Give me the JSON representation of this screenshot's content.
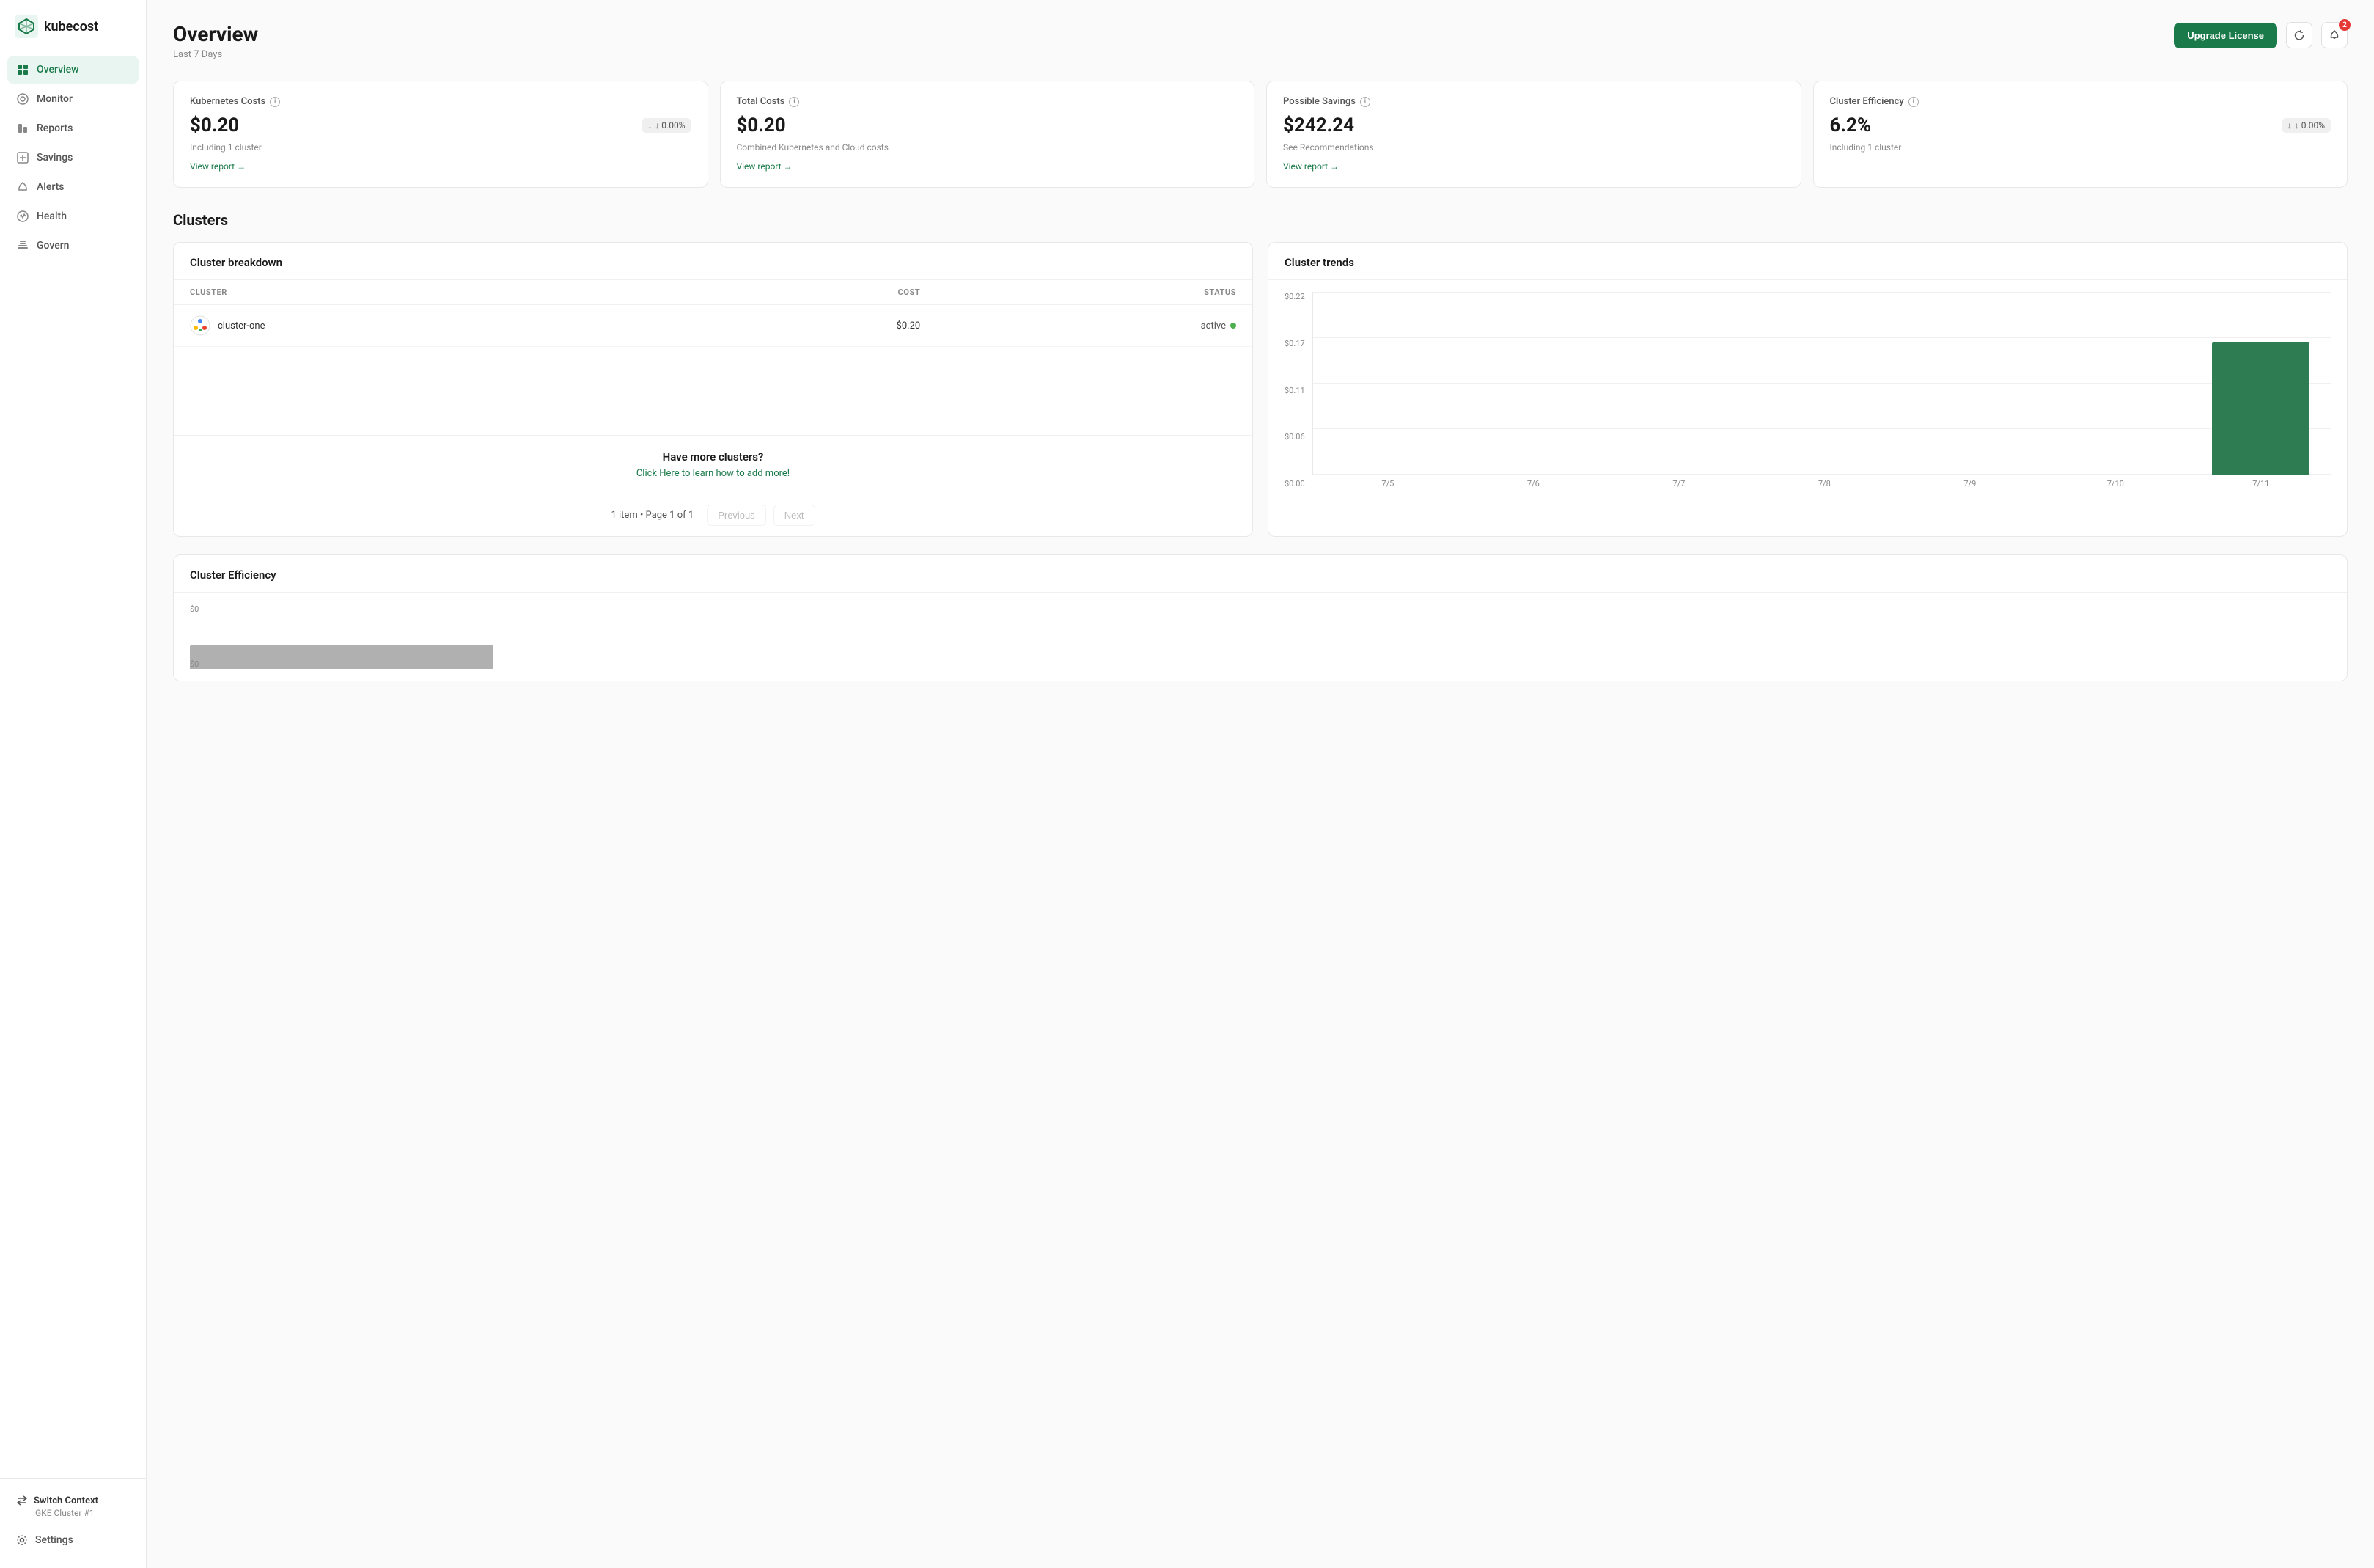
{
  "sidebar": {
    "logo_text": "kubecost",
    "nav_items": [
      {
        "id": "overview",
        "label": "Overview",
        "active": true
      },
      {
        "id": "monitor",
        "label": "Monitor",
        "active": false
      },
      {
        "id": "reports",
        "label": "Reports",
        "active": false
      },
      {
        "id": "savings",
        "label": "Savings",
        "active": false
      },
      {
        "id": "alerts",
        "label": "Alerts",
        "active": false
      },
      {
        "id": "health",
        "label": "Health",
        "active": false
      },
      {
        "id": "govern",
        "label": "Govern",
        "active": false
      }
    ],
    "switch_context_label": "Switch Context",
    "switch_context_sub": "GKE Cluster #1",
    "settings_label": "Settings"
  },
  "header": {
    "title": "Overview",
    "subtitle": "Last 7 Days",
    "upgrade_label": "Upgrade License",
    "notification_count": "2"
  },
  "metrics": [
    {
      "id": "kubernetes-costs",
      "label": "Kubernetes Costs",
      "value": "$0.20",
      "badge": "↓ 0.00%",
      "desc": "Including 1 cluster",
      "link": "View report →"
    },
    {
      "id": "total-costs",
      "label": "Total Costs",
      "value": "$0.20",
      "badge": null,
      "desc": "Combined Kubernetes and Cloud costs",
      "link": "View report →"
    },
    {
      "id": "possible-savings",
      "label": "Possible Savings",
      "value": "$242.24",
      "badge": null,
      "desc": "See Recommendations",
      "link": "View report →"
    },
    {
      "id": "cluster-efficiency",
      "label": "Cluster Efficiency",
      "value": "6.2%",
      "badge": "↓ 0.00%",
      "desc": "Including 1 cluster",
      "link": null
    }
  ],
  "clusters_section": {
    "title": "Clusters",
    "breakdown": {
      "title": "Cluster breakdown",
      "columns": [
        "CLUSTER",
        "COST",
        "STATUS"
      ],
      "rows": [
        {
          "name": "cluster-one",
          "cost": "$0.20",
          "status": "active"
        }
      ],
      "promo_title": "Have more clusters?",
      "promo_link": "Click Here to learn how to add more!",
      "pagination_info": "1 item • Page 1 of 1",
      "prev_label": "Previous",
      "next_label": "Next"
    },
    "trends": {
      "title": "Cluster trends",
      "y_labels": [
        "$0.22",
        "$0.17",
        "$0.11",
        "$0.06",
        "$0.00"
      ],
      "x_labels": [
        "7/5",
        "7/6",
        "7/7",
        "7/8",
        "7/9",
        "7/10",
        "7/11"
      ],
      "bars": [
        0,
        0,
        0,
        0,
        0,
        0,
        100
      ]
    },
    "efficiency": {
      "title": "Cluster Efficiency",
      "y_labels": [
        "$0",
        "$0"
      ],
      "bars": [
        40,
        0,
        0,
        0,
        0,
        0,
        0
      ]
    }
  }
}
